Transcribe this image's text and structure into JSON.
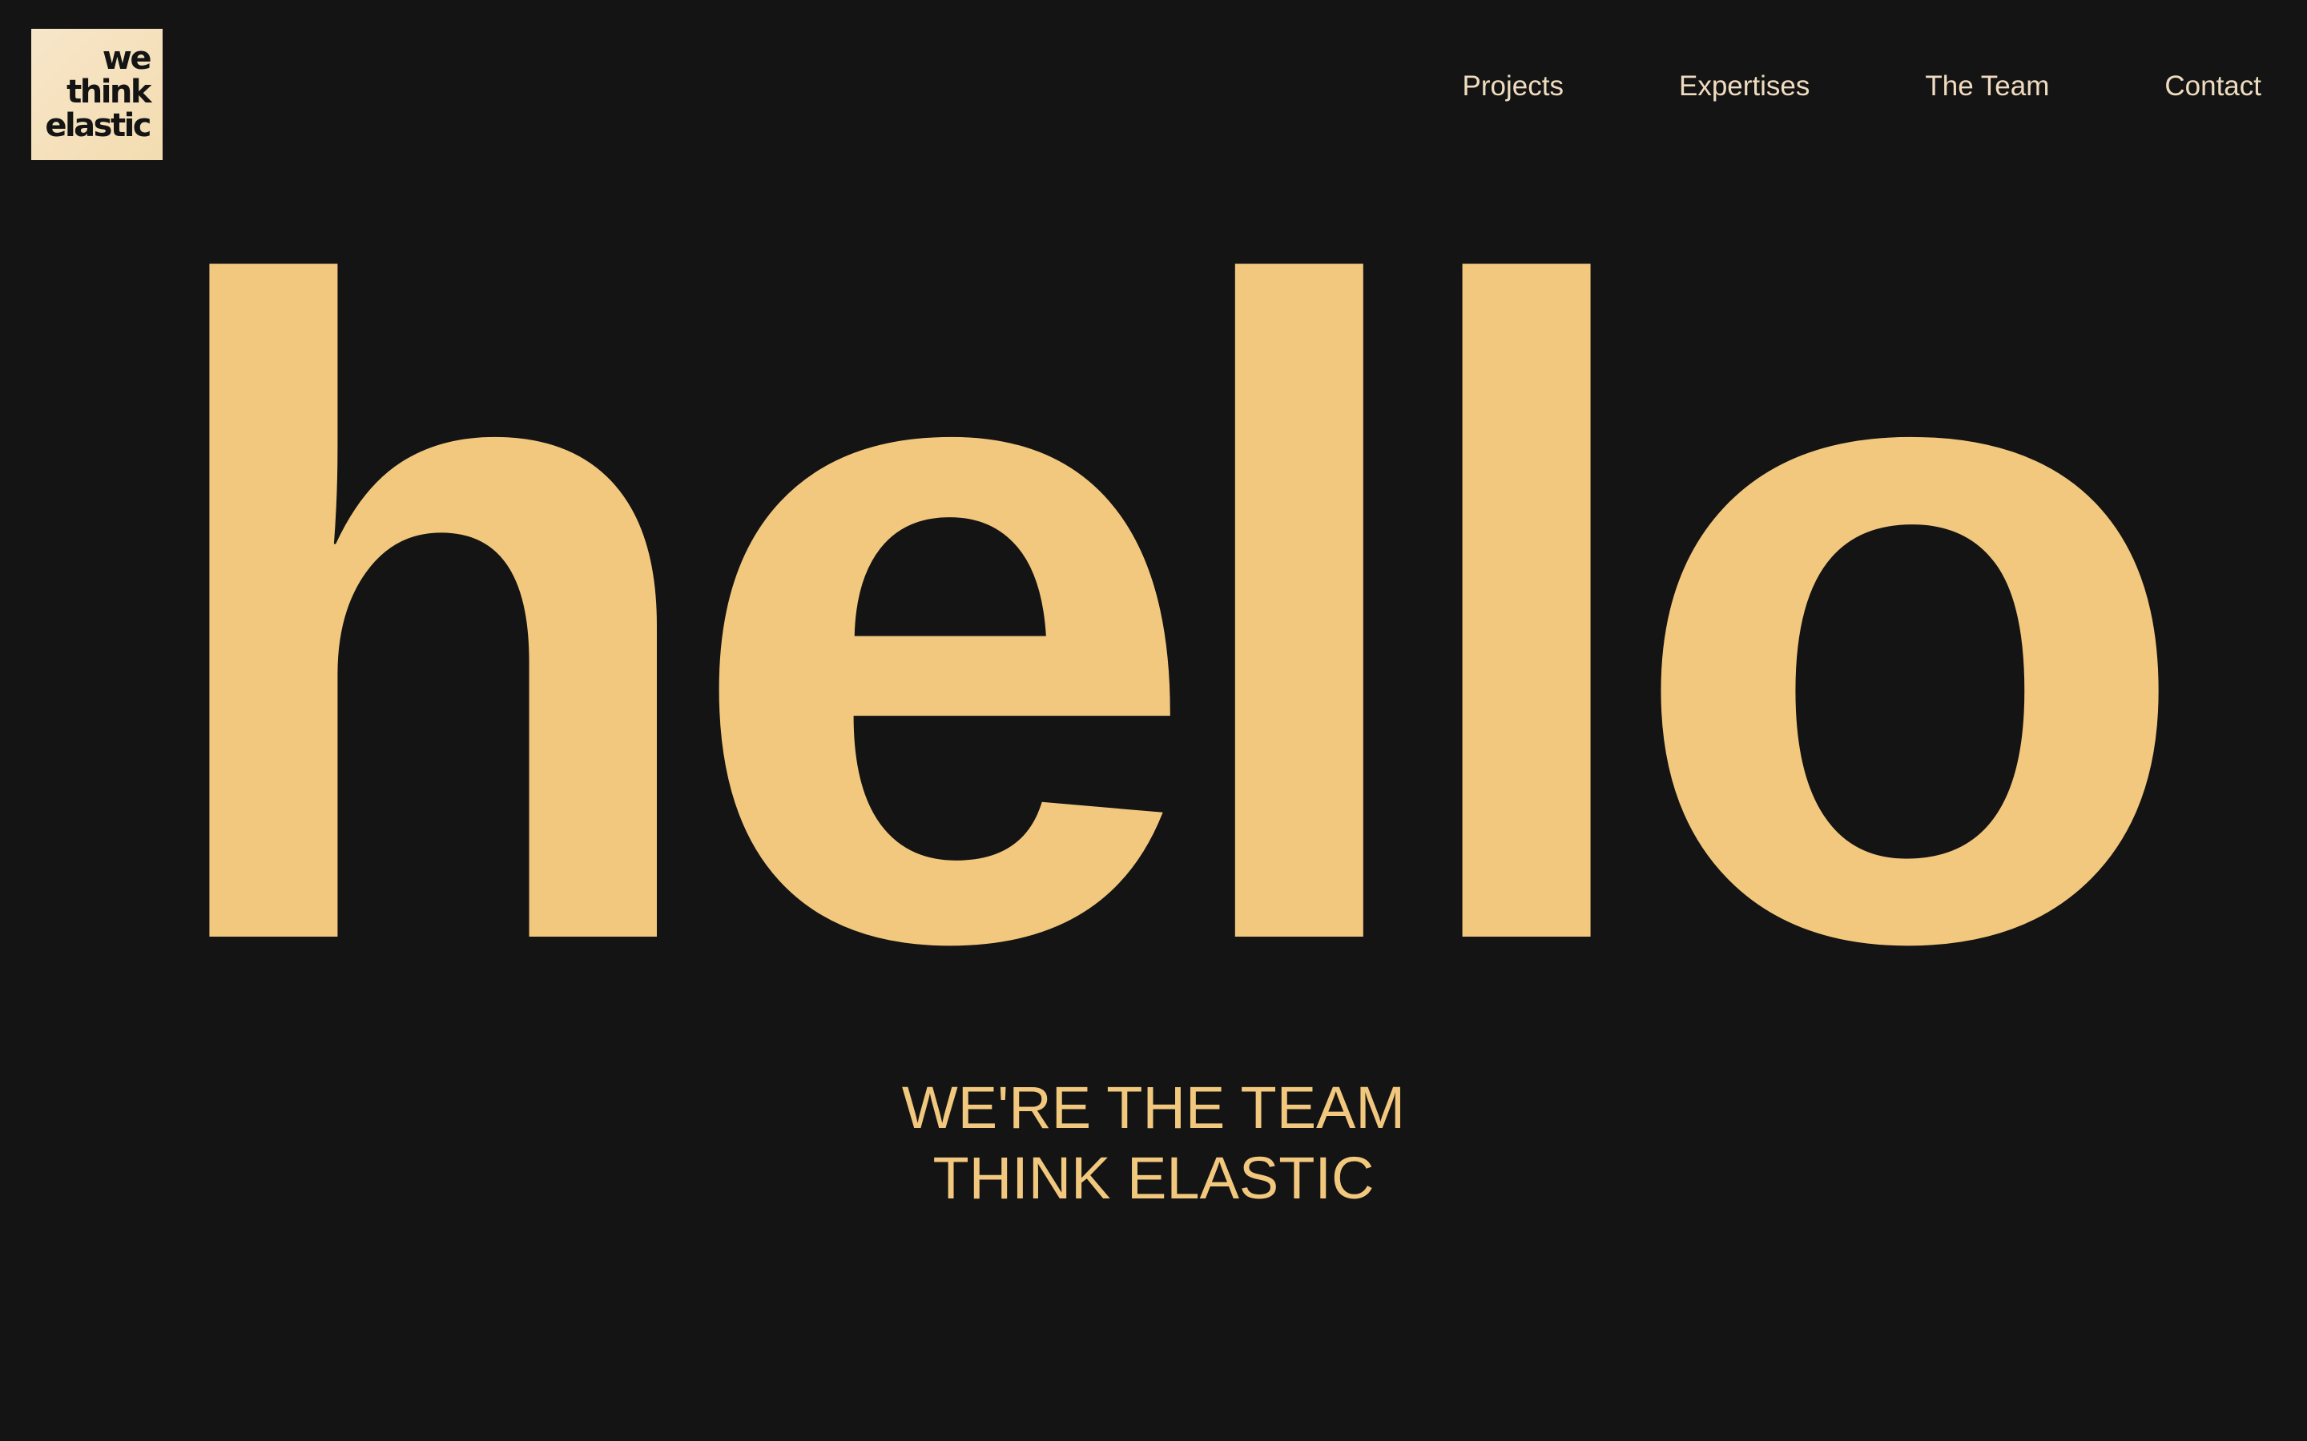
{
  "logo": {
    "line1": "we",
    "line2": "think",
    "line3": "elastic"
  },
  "nav": {
    "items": [
      "Projects",
      "Expertises",
      "The Team",
      "Contact"
    ]
  },
  "hero": {
    "headline": "hello"
  },
  "tagline": {
    "line1": "WE'RE THE TEAM",
    "line2": "THINK ELASTIC"
  },
  "colors": {
    "background": "#141414",
    "accent": "#f2c87e",
    "nav_text": "#efdcc0",
    "logo_bg": "#f5e2bd"
  }
}
